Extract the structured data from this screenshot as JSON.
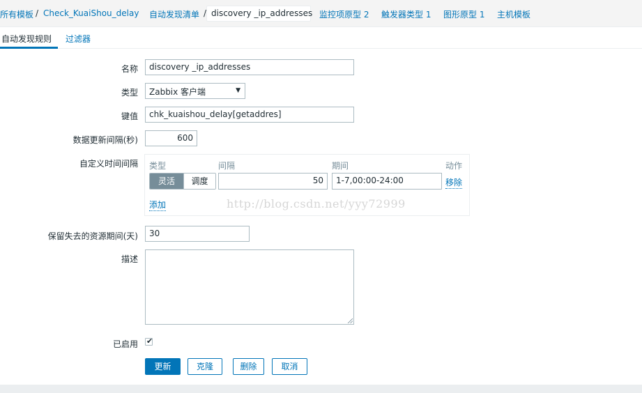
{
  "breadcrumb": {
    "all_templates": "所有模板",
    "template_name": "Check_KuaiShou_delay",
    "discovery_list": "自动发现清单",
    "current": "discovery _ip_addresses",
    "item_prototypes": "监控项原型 2",
    "trigger_prototypes": "触发器类型 1",
    "graph_prototypes": "图形原型 1",
    "host_prototypes": "主机模板",
    "separator": "/"
  },
  "tabs": {
    "rule": "自动发现规则",
    "filters": "过滤器"
  },
  "form": {
    "name_label": "名称",
    "name_value": "discovery _ip_addresses",
    "type_label": "类型",
    "type_value": "Zabbix 客户端",
    "key_label": "键值",
    "key_value": "chk_kuaishou_delay[getaddres]",
    "interval_label": "数据更新间隔(秒)",
    "interval_value": "600",
    "custom_intervals_label": "自定义时间间隔",
    "keep_lost_label": "保留失去的资源期间(天)",
    "keep_lost_value": "30",
    "description_label": "描述",
    "description_value": "",
    "enabled_label": "已启用",
    "enabled": true
  },
  "custom_intervals": {
    "headers": {
      "type": "类型",
      "interval": "间隔",
      "period": "期间",
      "action": "动作"
    },
    "rows": [
      {
        "type_flexible": "灵活",
        "type_scheduling": "调度",
        "interval": "50",
        "period": "1-7,00:00-24:00",
        "remove": "移除"
      }
    ],
    "add": "添加"
  },
  "watermark": "http://blog.csdn.net/yyy72999",
  "buttons": {
    "update": "更新",
    "clone": "克隆",
    "delete": "删除",
    "cancel": "取消"
  },
  "colors": {
    "link": "#0275b8",
    "text": "#1f2c33",
    "segment_active": "#768d99"
  }
}
